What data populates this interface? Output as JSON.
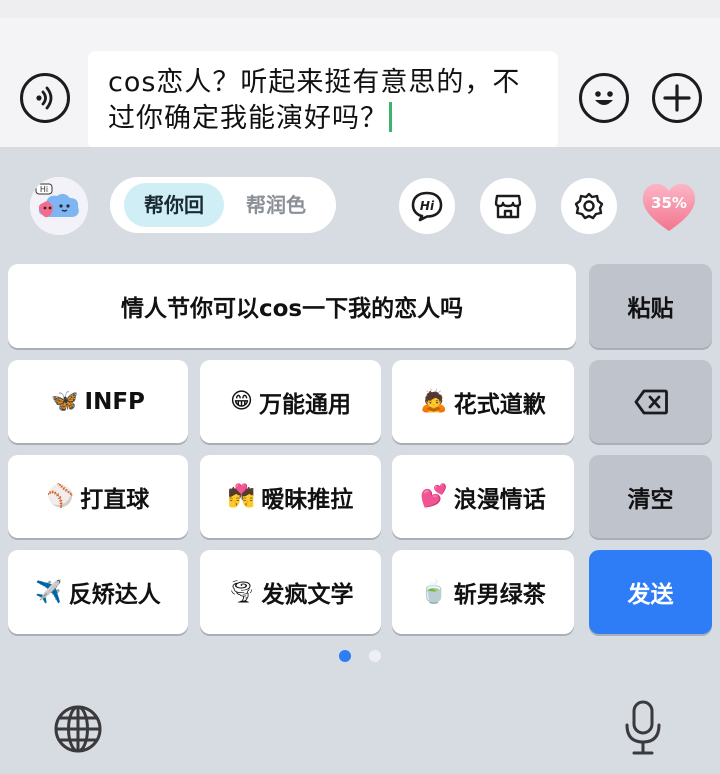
{
  "composer": {
    "text": "cos恋人？听起来挺有意思的，不过你确定我能演好吗？",
    "voice_icon": "voice-wave-icon",
    "emoji_icon": "smiley-icon",
    "plus_icon": "plus-icon"
  },
  "assistant": {
    "avatar_badge": "Hi",
    "tabs": [
      {
        "label": "帮你回",
        "active": true
      },
      {
        "label": "帮润色",
        "active": false
      }
    ],
    "tools": [
      {
        "icon": "hi-chat-icon",
        "label": "Hi"
      },
      {
        "icon": "store-icon"
      },
      {
        "icon": "settings-gear-icon"
      }
    ],
    "heart_percent": "35%"
  },
  "suggestions": {
    "top_phrase": "情人节你可以cos一下我的恋人吗",
    "chips": [
      {
        "emoji": "🦋",
        "label": "INFP"
      },
      {
        "emoji": "😁",
        "label": "万能通用"
      },
      {
        "emoji": "🙇",
        "label": "花式道歉"
      },
      {
        "emoji": "⚾",
        "label": "打直球"
      },
      {
        "emoji": "💏",
        "label": "暧昧推拉"
      },
      {
        "emoji": "💕",
        "label": "浪漫情话"
      },
      {
        "emoji": "✈️",
        "label": "反矫达人"
      },
      {
        "emoji": "🌪",
        "label": "发疯文学"
      },
      {
        "emoji": "🍵",
        "label": "斩男绿茶"
      }
    ]
  },
  "side_keys": {
    "paste": "粘贴",
    "delete_icon": "backspace-icon",
    "clear": "清空",
    "send": "发送"
  },
  "pager": {
    "current": 1,
    "total": 2
  },
  "bottom": {
    "globe_icon": "globe-icon",
    "mic_icon": "microphone-icon"
  },
  "colors": {
    "accent": "#2f7df6",
    "tab_active_bg": "#cfeef6",
    "heart": "#f58aa4",
    "caret": "#3cb371"
  }
}
